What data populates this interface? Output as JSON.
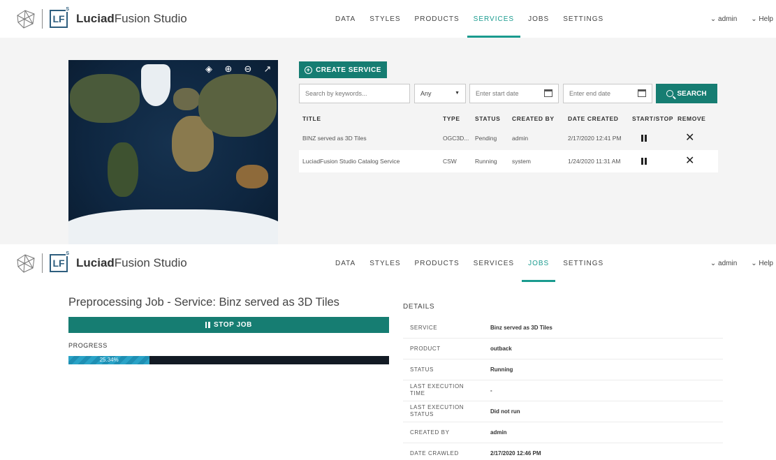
{
  "app": {
    "brand_logo": "LF",
    "brand_superscript": "S",
    "brand_name_bold": "Luciad",
    "brand_name_rest": "Fusion Studio"
  },
  "nav": {
    "items": [
      "DATA",
      "STYLES",
      "PRODUCTS",
      "SERVICES",
      "JOBS",
      "SETTINGS"
    ]
  },
  "user_menu": {
    "user": "⌄ admin",
    "help": "⌄ Help"
  },
  "colors": {
    "accent": "#167d72",
    "active_nav": "#1a9b8f",
    "progress": "#2aa3c7"
  },
  "services_page": {
    "active_nav": "SERVICES",
    "create_button": "CREATE SERVICE",
    "search_placeholder": "Search by keywords...",
    "type_select": "Any",
    "start_date_placeholder": "Enter start date",
    "end_date_placeholder": "Enter end date",
    "search_button": "SEARCH",
    "columns": [
      "TITLE",
      "TYPE",
      "STATUS",
      "CREATED BY",
      "DATE CREATED",
      "START/STOP",
      "REMOVE"
    ],
    "rows": [
      {
        "title": "BINZ served as 3D Tiles",
        "type": "OGC3D...",
        "status": "Pending",
        "created_by": "admin",
        "date_created": "2/17/2020 12:41 PM"
      },
      {
        "title": "LuciadFusion Studio Catalog Service",
        "type": "CSW",
        "status": "Running",
        "created_by": "system",
        "date_created": "1/24/2020 11:31 AM"
      }
    ]
  },
  "job_page": {
    "active_nav": "JOBS",
    "title": "Preprocessing Job - Service: Binz served as 3D Tiles",
    "stop_button": "STOP JOB",
    "progress_label": "PROGRESS",
    "progress_value": 25.34,
    "progress_text": "25.34%",
    "details_title": "DETAILS",
    "details": [
      {
        "label": "SERVICE",
        "value": "Binz served as 3D Tiles"
      },
      {
        "label": "PRODUCT",
        "value": "outback"
      },
      {
        "label": "STATUS",
        "value": "Running"
      },
      {
        "label": "LAST EXECUTION TIME",
        "value": "-"
      },
      {
        "label": "LAST EXECUTION STATUS",
        "value": "Did not run"
      },
      {
        "label": "CREATED BY",
        "value": "admin"
      },
      {
        "label": "DATE CRAWLED",
        "value": "2/17/2020 12:46 PM"
      }
    ]
  }
}
